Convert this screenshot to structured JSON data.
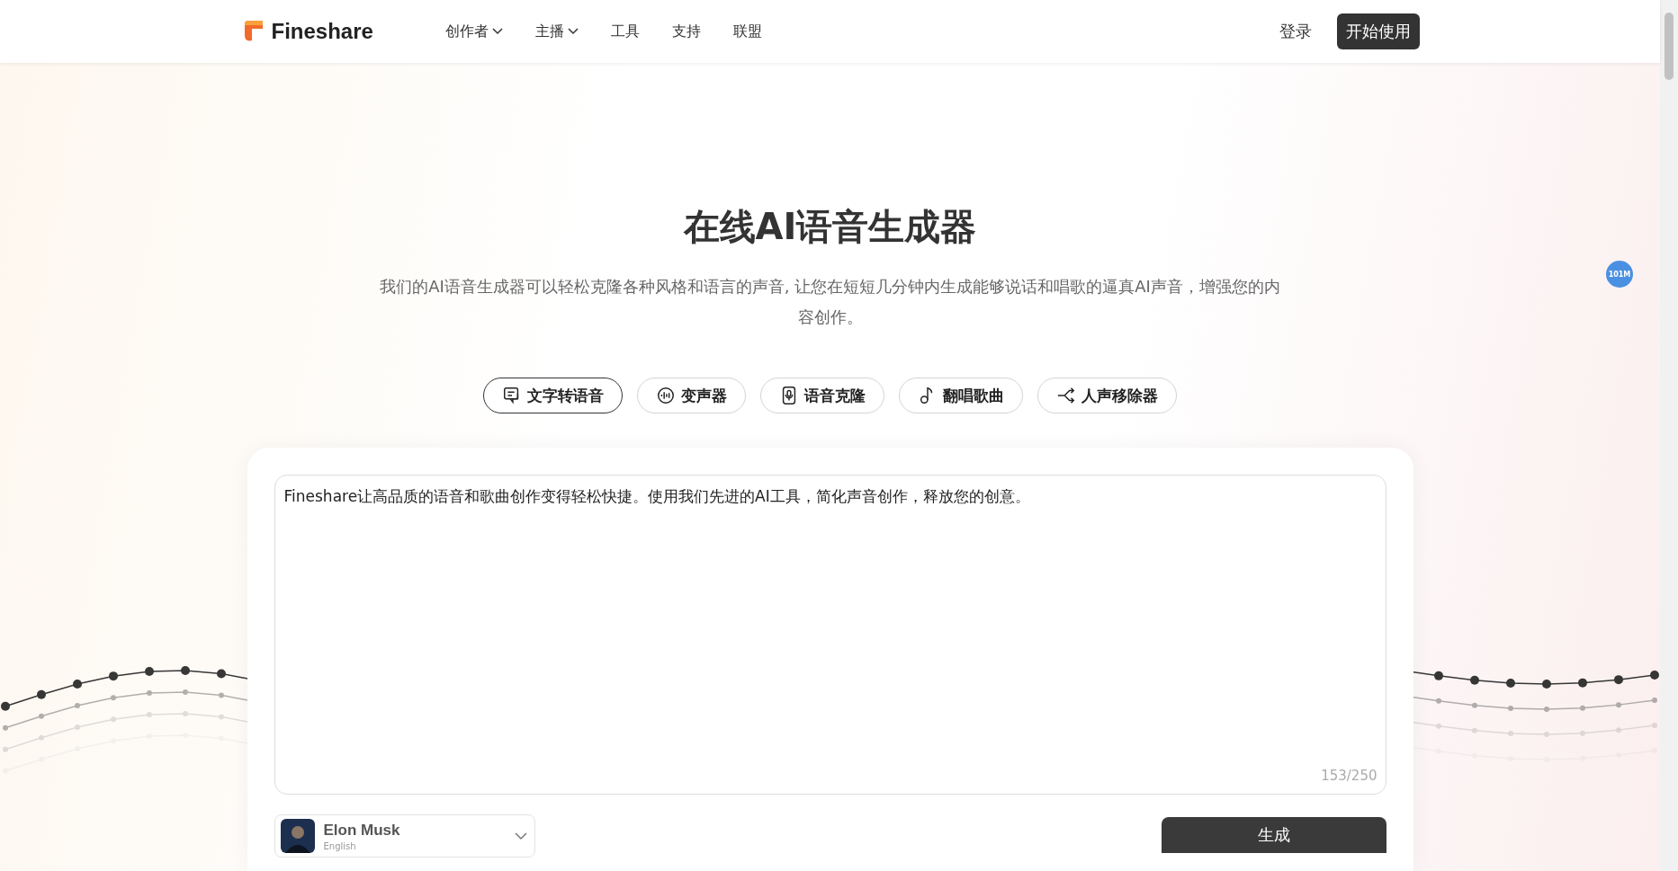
{
  "header": {
    "logo": "Fineshare",
    "nav": [
      {
        "label": "创作者",
        "dropdown": true
      },
      {
        "label": "主播",
        "dropdown": true
      },
      {
        "label": "工具",
        "dropdown": false
      },
      {
        "label": "支持",
        "dropdown": false
      },
      {
        "label": "联盟",
        "dropdown": false
      }
    ],
    "login": "登录",
    "cta": "开始使用"
  },
  "hero": {
    "title": "在线AI语音生成器",
    "subtitle": "我们的AI语音生成器可以轻松克隆各种风格和语言的声音, 让您在短短几分钟内生成能够说话和唱歌的逼真AI声音，增强您的内容创作。"
  },
  "tabs": [
    {
      "label": "文字转语音",
      "kind": "chat",
      "selected": true
    },
    {
      "label": "变声器",
      "kind": "wave",
      "selected": false
    },
    {
      "label": "语音克隆",
      "kind": "mic",
      "selected": false
    },
    {
      "label": "翻唱歌曲",
      "kind": "note",
      "selected": false
    },
    {
      "label": "人声移除器",
      "kind": "split",
      "selected": false
    }
  ],
  "editor": {
    "text": "Fineshare让高品质的语音和歌曲创作变得轻松快捷。使用我们先进的AI工具，简化声音创作，释放您的创意。",
    "counter": "153/250"
  },
  "voice": {
    "name": "Elon Musk",
    "language": "English"
  },
  "generate": "生成",
  "badge": "101M"
}
